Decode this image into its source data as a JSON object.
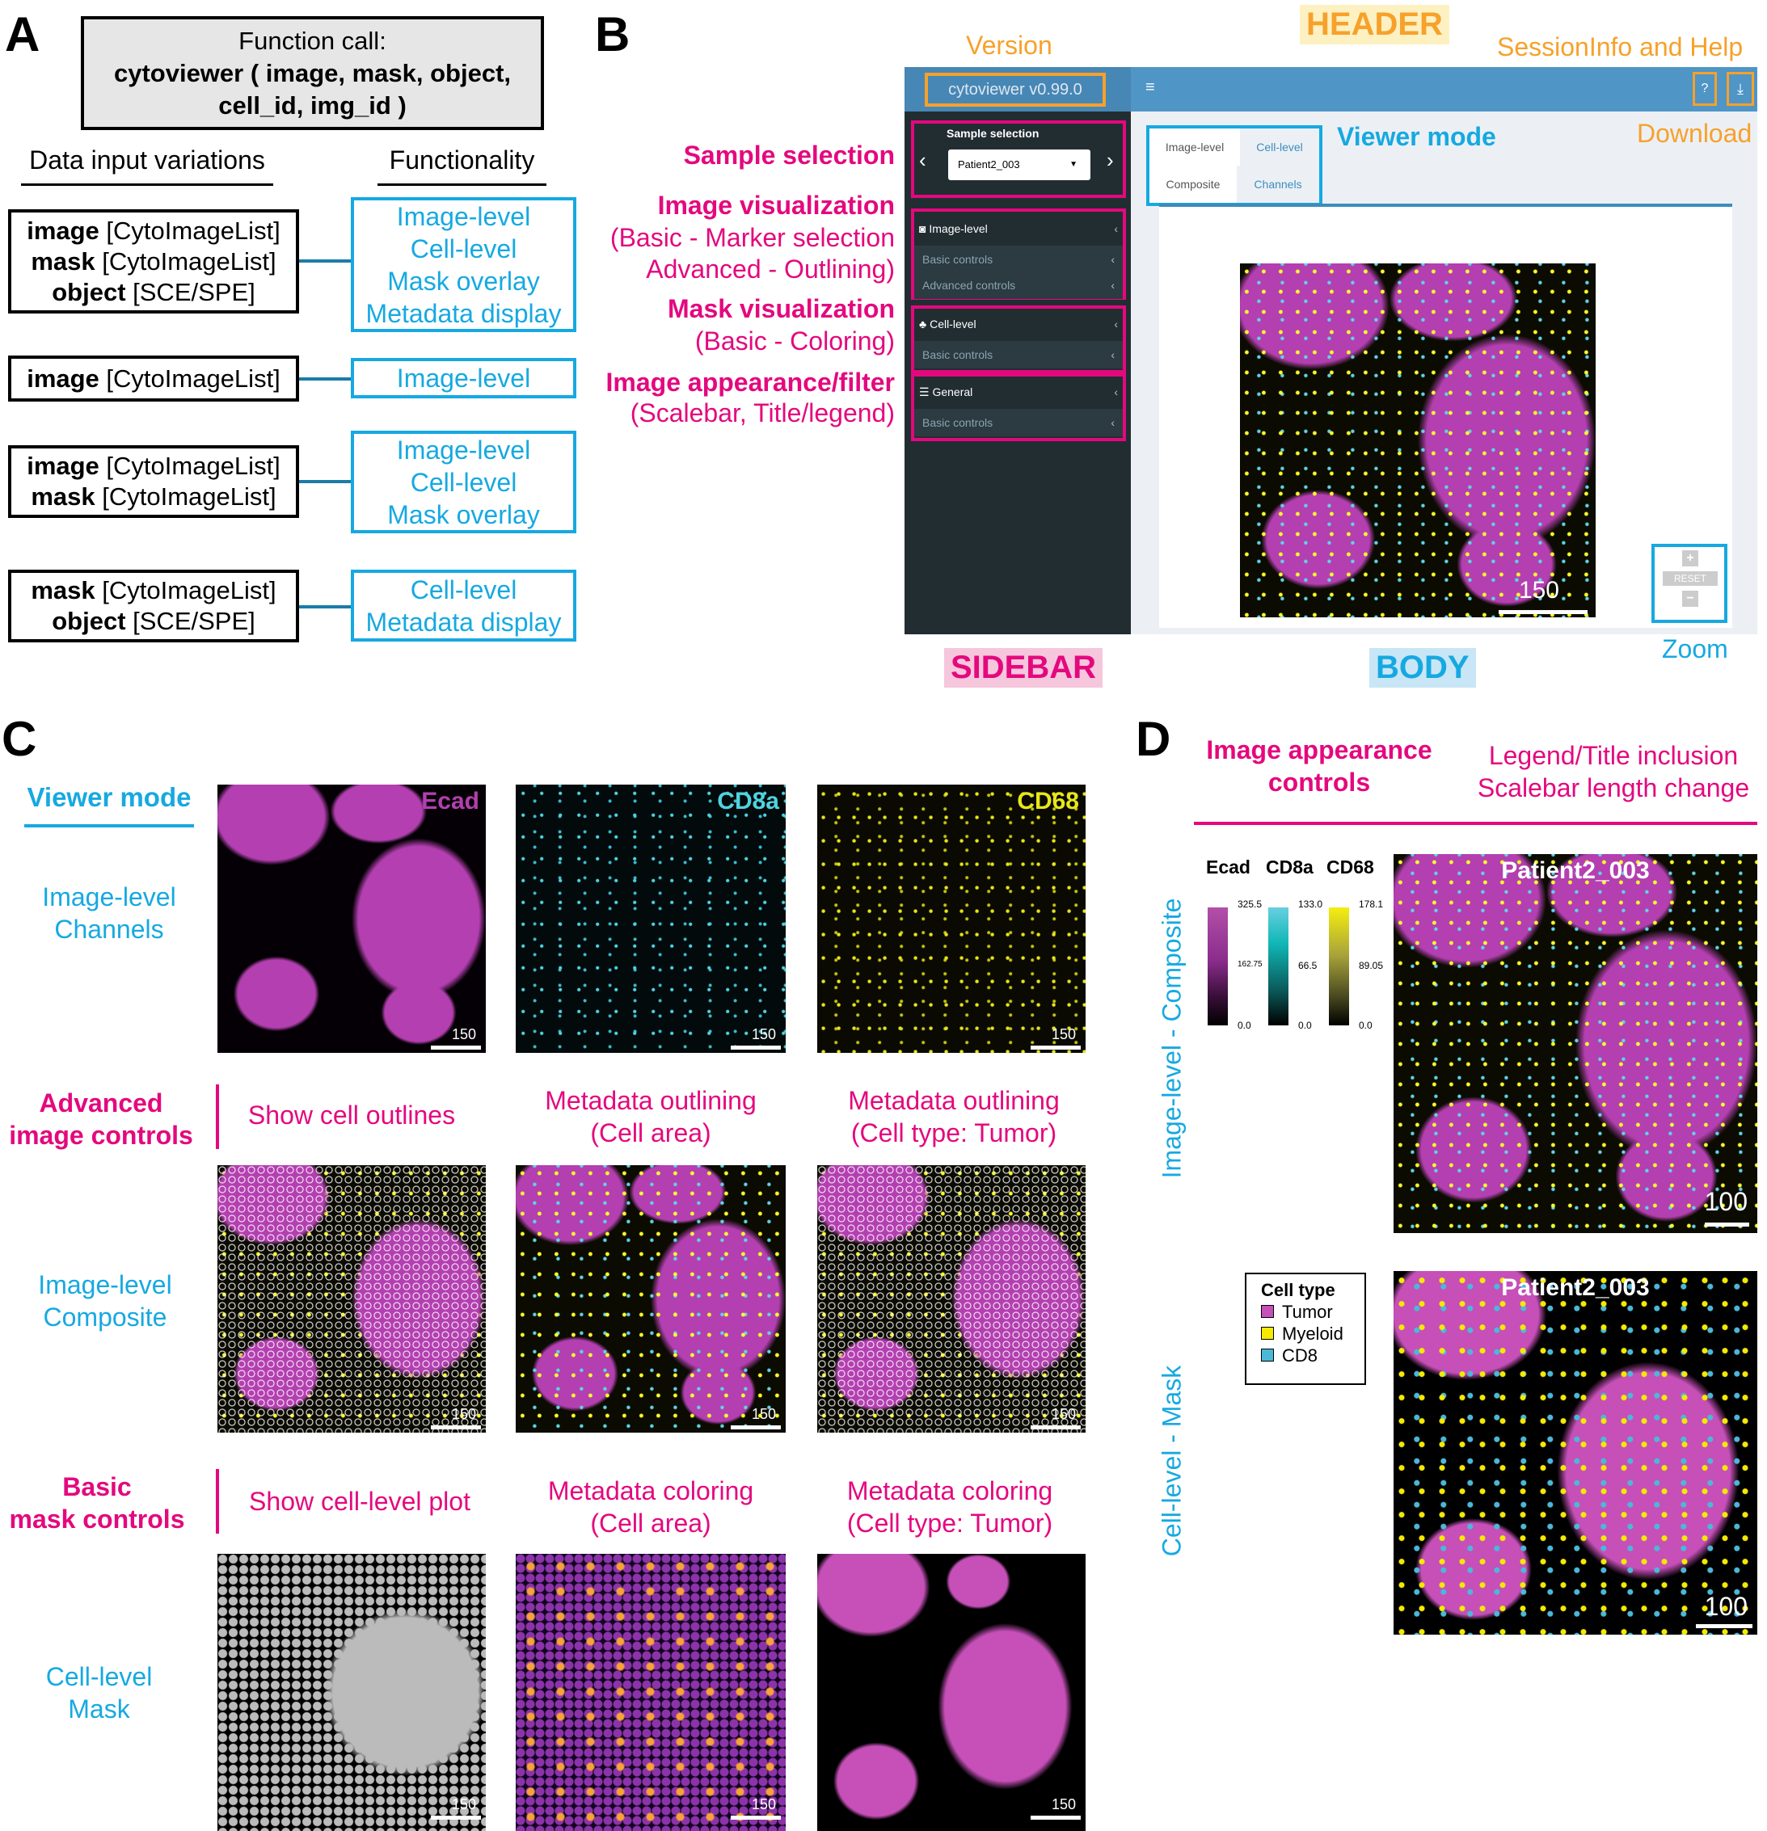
{
  "panels": {
    "a": "A",
    "b": "B",
    "c": "C",
    "d": "D"
  },
  "panel_a": {
    "function_call": [
      "Function call:",
      "cytoviewer ( image, mask, object,",
      "cell_id, img_id )"
    ],
    "input_header": "Data input variations",
    "func_header": "Functionality",
    "rows": [
      {
        "inputs": [
          {
            "b": "image",
            "t": " [CytoImageList]"
          },
          {
            "b": "mask",
            "t": " [CytoImageList]"
          },
          {
            "b": "object",
            "t": " [SCE/SPE]"
          }
        ],
        "funcs": [
          "Image-level",
          "Cell-level",
          "Mask overlay",
          "Metadata display"
        ]
      },
      {
        "inputs": [
          {
            "b": "image",
            "t": " [CytoImageList]"
          }
        ],
        "funcs": [
          "Image-level"
        ]
      },
      {
        "inputs": [
          {
            "b": "image",
            "t": " [CytoImageList]"
          },
          {
            "b": "mask",
            "t": " [CytoImageList]"
          }
        ],
        "funcs": [
          "Image-level",
          "Cell-level",
          "Mask overlay"
        ]
      },
      {
        "inputs": [
          {
            "b": "mask",
            "t": " [CytoImageList]"
          },
          {
            "b": "object",
            "t": " [SCE/SPE]"
          }
        ],
        "funcs": [
          "Cell-level",
          "Metadata display"
        ]
      }
    ]
  },
  "panel_b": {
    "annotations": {
      "version": "Version",
      "header": "HEADER",
      "session": "SessionInfo and Help",
      "sidebar": "SIDEBAR",
      "body": "BODY",
      "zoom": "Zoom",
      "viewer_mode": "Viewer mode",
      "download": "Download"
    },
    "left_labels": {
      "sample": "Sample selection",
      "imgvis": "Image visualization",
      "imgvis1": "(Basic - Marker selection",
      "imgvis2": "Advanced - Outlining)",
      "maskvis": "Mask visualization",
      "maskvis1": "(Basic - Coloring)",
      "appear": "Image appearance/filter",
      "appear1": "(Scalebar, Title/legend)"
    },
    "app": {
      "version": "cytoviewer v0.99.0",
      "menu_icon": "≡",
      "help_icon": "?",
      "download_icon": "⤓",
      "sample_label": "Sample selection",
      "sample_value": "Patient2_003",
      "sections": [
        {
          "label": "Image-level",
          "icon": "camera",
          "subs": [
            "Basic controls",
            "Advanced controls"
          ]
        },
        {
          "label": "Cell-level",
          "icon": "cells",
          "subs": [
            "Basic controls"
          ]
        },
        {
          "label": "General",
          "icon": "sliders",
          "subs": [
            "Basic controls"
          ]
        }
      ],
      "tabs": {
        "top": [
          "Image-level",
          "Cell-level"
        ],
        "bottom": [
          "Composite",
          "Channels"
        ]
      },
      "scalebar": "150",
      "reset": "RESET"
    }
  },
  "panel_c": {
    "viewer_mode": "Viewer mode",
    "row_labels": {
      "channels": [
        "Image-level",
        "Channels"
      ],
      "advanced": [
        "Advanced",
        "image controls"
      ],
      "composite": [
        "Image-level",
        "Composite"
      ],
      "basic": [
        "Basic",
        "mask controls"
      ],
      "mask": [
        "Cell-level",
        "Mask"
      ]
    },
    "channels": [
      "Ecad",
      "CD8a",
      "CD68"
    ],
    "channel_colors": [
      "#b33fb0",
      "#4fd3e0",
      "#e8e61a"
    ],
    "advanced_cols": [
      [
        "Show cell outlines"
      ],
      [
        "Metadata outlining",
        "(Cell area)"
      ],
      [
        "Metadata outlining",
        "(Cell type: Tumor)"
      ]
    ],
    "basic_cols": [
      [
        "Show cell-level plot"
      ],
      [
        "Metadata coloring",
        "(Cell area)"
      ],
      [
        "Metadata coloring",
        "(Cell type: Tumor)"
      ]
    ],
    "scalebar": "150"
  },
  "panel_d": {
    "header1": [
      "Image appearance",
      "controls"
    ],
    "header2": [
      "Legend/Title inclusion",
      "Scalebar length change"
    ],
    "side1": "Image-level - Composite",
    "side2": "Cell-level - Mask",
    "legend": [
      {
        "name": "Ecad",
        "max": "325.5",
        "mid": "162.75",
        "min": "0.0"
      },
      {
        "name": "CD8a",
        "max": "133.0",
        "mid": "66.5",
        "min": "0.0"
      },
      {
        "name": "CD68",
        "max": "178.1",
        "mid": "89.05",
        "min": "0.0"
      }
    ],
    "title": "Patient2_003",
    "scalebar": "100",
    "celltype": {
      "title": "Cell type",
      "items": [
        {
          "label": "Tumor",
          "color": "#c64fb8"
        },
        {
          "label": "Myeloid",
          "color": "#f5ea00"
        },
        {
          "label": "CD8",
          "color": "#4cb8d8"
        }
      ]
    }
  }
}
